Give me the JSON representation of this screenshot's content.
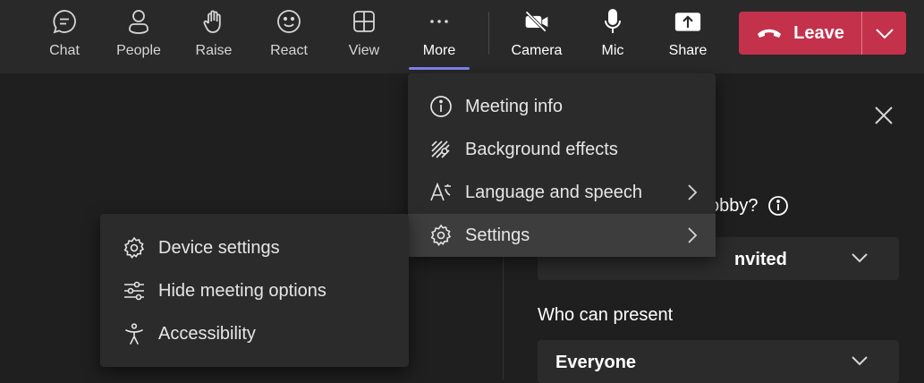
{
  "toolbar": {
    "buttons": [
      {
        "label": "Chat",
        "icon": "chat-icon"
      },
      {
        "label": "People",
        "icon": "people-icon"
      },
      {
        "label": "Raise",
        "icon": "raise-hand-icon"
      },
      {
        "label": "React",
        "icon": "react-smiley-icon"
      },
      {
        "label": "View",
        "icon": "view-grid-icon"
      },
      {
        "label": "More",
        "icon": "more-icon"
      },
      {
        "label": "Camera",
        "icon": "camera-off-icon"
      },
      {
        "label": "Mic",
        "icon": "mic-icon"
      },
      {
        "label": "Share",
        "icon": "share-icon"
      }
    ],
    "leave": {
      "label": "Leave",
      "icon": "phone-hangup-icon",
      "caret_icon": "chevron-down-icon"
    }
  },
  "more_menu": {
    "items": [
      {
        "label": "Meeting info",
        "icon": "info-icon"
      },
      {
        "label": "Background effects",
        "icon": "background-effects-icon"
      },
      {
        "label": "Language and speech",
        "icon": "language-icon",
        "submenu": true
      },
      {
        "label": "Settings",
        "icon": "gear-icon",
        "submenu": true,
        "active": true
      }
    ]
  },
  "settings_submenu": {
    "items": [
      {
        "label": "Device settings",
        "icon": "gear-icon"
      },
      {
        "label": "Hide meeting options",
        "icon": "sliders-icon"
      },
      {
        "label": "Accessibility",
        "icon": "accessibility-icon"
      }
    ]
  },
  "options_panel": {
    "lobby_question_visible": "obby?",
    "lobby_select_value_visible": "nvited",
    "who_can_present_label": "Who can present",
    "who_can_present_value": "Everyone"
  },
  "colors": {
    "leave_red": "#c4314b",
    "accent_underline": "#7f85f5",
    "toolbar_bg": "#292929",
    "menu_bg": "#2b2b2b"
  }
}
